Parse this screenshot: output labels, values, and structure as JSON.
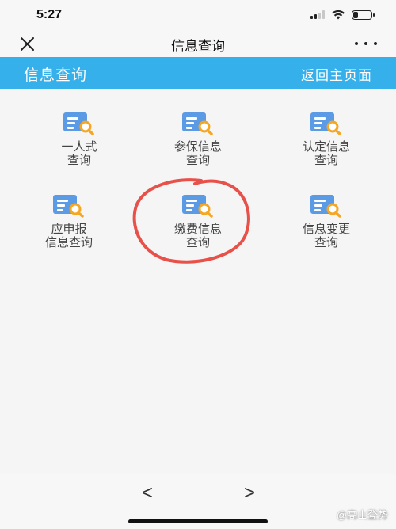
{
  "status_bar": {
    "time": "5:27",
    "battery_level_percent": 30
  },
  "nav": {
    "title": "信息查询",
    "close_icon": "close-icon",
    "more_icon": "more-icon"
  },
  "header": {
    "title": "信息查询",
    "back_label": "返回主页面"
  },
  "grid": [
    {
      "label": "一人式\n查询",
      "icon": "document-search-icon"
    },
    {
      "label": "参保信息\n查询",
      "icon": "document-search-icon"
    },
    {
      "label": "认定信息\n查询",
      "icon": "document-search-icon"
    },
    {
      "label": "应申报\n信息查询",
      "icon": "document-search-icon"
    },
    {
      "label": "缴费信息\n查询",
      "icon": "document-search-icon",
      "circled": true
    },
    {
      "label": "信息变更\n查询",
      "icon": "document-search-icon"
    }
  ],
  "bottom_nav": {
    "back": "<",
    "forward": ">"
  },
  "watermark": "@高山登势",
  "colors": {
    "accent": "#35b0ea",
    "icon_blue": "#5b9be6",
    "icon_orange": "#f5a623",
    "annotation_red": "#e8504a"
  }
}
